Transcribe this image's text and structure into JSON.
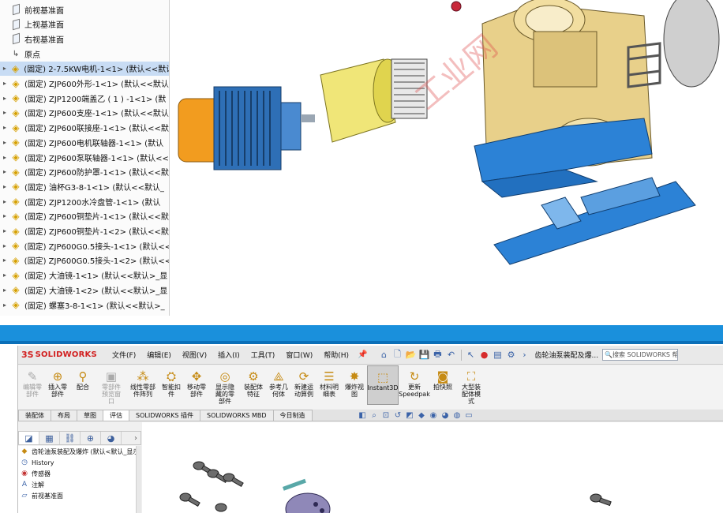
{
  "tree": {
    "items": [
      {
        "label": "前视基准面",
        "type": "plane"
      },
      {
        "label": "上视基准面",
        "type": "plane"
      },
      {
        "label": "右视基准面",
        "type": "plane"
      },
      {
        "label": "原点",
        "type": "origin"
      },
      {
        "label": "(固定) 2-7.5KW电机-1<1> (默认<<默认",
        "type": "part",
        "selected": true
      },
      {
        "label": "(固定) ZJP600外形-1<1> (默认<<默认",
        "type": "part"
      },
      {
        "label": "(固定) ZJP1200端盖乙 ( 1 ) -1<1> (默",
        "type": "part"
      },
      {
        "label": "(固定) ZJP600支座-1<1> (默认<<默认",
        "type": "part"
      },
      {
        "label": "(固定) ZJP600联接座-1<1> (默认<<默",
        "type": "part"
      },
      {
        "label": "(固定) ZJP600电机联轴器-1<1> (默认",
        "type": "part"
      },
      {
        "label": "(固定) ZJP600泵联轴器-1<1> (默认<<",
        "type": "part"
      },
      {
        "label": "(固定) ZJP600防护罩-1<1> (默认<<默",
        "type": "part"
      },
      {
        "label": "(固定) 油杯G3-8-1<1> (默认<<默认_",
        "type": "part"
      },
      {
        "label": "(固定) ZJP1200水冷盘管-1<1> (默认",
        "type": "part"
      },
      {
        "label": "(固定) ZJP600铜垫片-1<1> (默认<<默",
        "type": "part"
      },
      {
        "label": "(固定) ZJP600铜垫片-1<2> (默认<<默",
        "type": "part"
      },
      {
        "label": "(固定) ZJP600G0.5接头-1<1> (默认<<",
        "type": "part"
      },
      {
        "label": "(固定) ZJP600G0.5接头-1<2> (默认<<",
        "type": "part"
      },
      {
        "label": "(固定) 大油镜-1<1> (默认<<默认>_显",
        "type": "part"
      },
      {
        "label": "(固定) 大油镜-1<2> (默认<<默认>_显",
        "type": "part"
      },
      {
        "label": "(固定) 螺塞3-8-1<1> (默认<<默认>_",
        "type": "part"
      }
    ]
  },
  "app": {
    "logo_ds": "3S",
    "logo_text": "SOLIDWORKS",
    "menu": [
      "文件(F)",
      "编辑(E)",
      "视图(V)",
      "插入(I)",
      "工具(T)",
      "窗口(W)",
      "帮助(H)"
    ],
    "doc_title": "齿轮油泵装配及爆...",
    "search_placeholder": "搜索 SOLIDWORKS 帮助",
    "commands": [
      {
        "label": "编辑零\n部件",
        "icon": "edit-component-icon",
        "glyph": "✎",
        "disabled": true
      },
      {
        "label": "插入零\n部件",
        "icon": "insert-component-icon",
        "glyph": "⊕"
      },
      {
        "label": "配合",
        "icon": "mate-icon",
        "glyph": "⚲"
      },
      {
        "label": "零部件\n预览窗\n口",
        "icon": "preview-window-icon",
        "glyph": "▣",
        "disabled": true
      },
      {
        "label": "线性零部\n件阵列",
        "icon": "linear-pattern-icon",
        "glyph": "⁂"
      },
      {
        "label": "智能扣\n件",
        "icon": "smart-fastener-icon",
        "glyph": "⛭"
      },
      {
        "label": "移动零\n部件",
        "icon": "move-component-icon",
        "glyph": "✥"
      },
      {
        "label": "显示隐\n藏的零\n部件",
        "icon": "show-hidden-icon",
        "glyph": "◎"
      },
      {
        "label": "装配体\n特征",
        "icon": "assembly-feature-icon",
        "glyph": "⚙"
      },
      {
        "label": "参考几\n何体",
        "icon": "reference-geometry-icon",
        "glyph": "⟁"
      },
      {
        "label": "新建运\n动算例",
        "icon": "motion-study-icon",
        "glyph": "⟳"
      },
      {
        "label": "材料明\n细表",
        "icon": "bom-icon",
        "glyph": "☰"
      },
      {
        "label": "爆炸视\n图",
        "icon": "exploded-view-icon",
        "glyph": "✸"
      },
      {
        "label": "Instant3D",
        "icon": "instant3d-icon",
        "glyph": "⬚",
        "active": true
      },
      {
        "label": "更新\nSpeedpak",
        "icon": "speedpak-icon",
        "glyph": "↻"
      },
      {
        "label": "拍快照",
        "icon": "snapshot-icon",
        "glyph": "◙"
      },
      {
        "label": "大型装\n配体模\n式",
        "icon": "large-assembly-icon",
        "glyph": "⛶"
      }
    ],
    "tabs": [
      "装配体",
      "布局",
      "草图",
      "评估",
      "SOLIDWORKS 插件",
      "SOLIDWORKS MBD",
      "今日制造"
    ],
    "active_tab": "评估",
    "fm_tree": [
      {
        "label": "齿轮油泵装配及爆炸 (默认<默认_显示",
        "icon": "assembly-icon",
        "glyph": "◆"
      },
      {
        "label": "History",
        "icon": "history-icon",
        "glyph": "◷",
        "color": "blue"
      },
      {
        "label": "传感器",
        "icon": "sensor-icon",
        "glyph": "◉",
        "color": "red"
      },
      {
        "label": "注解",
        "icon": "annotation-icon",
        "glyph": "A",
        "color": "blue"
      },
      {
        "label": "前视基准面",
        "icon": "plane-icon",
        "glyph": "▱",
        "color": "blue"
      }
    ]
  },
  "colors": {
    "divider": "#1a90dc",
    "selection": "#c8dcf4",
    "brand": "#d21f1f"
  }
}
